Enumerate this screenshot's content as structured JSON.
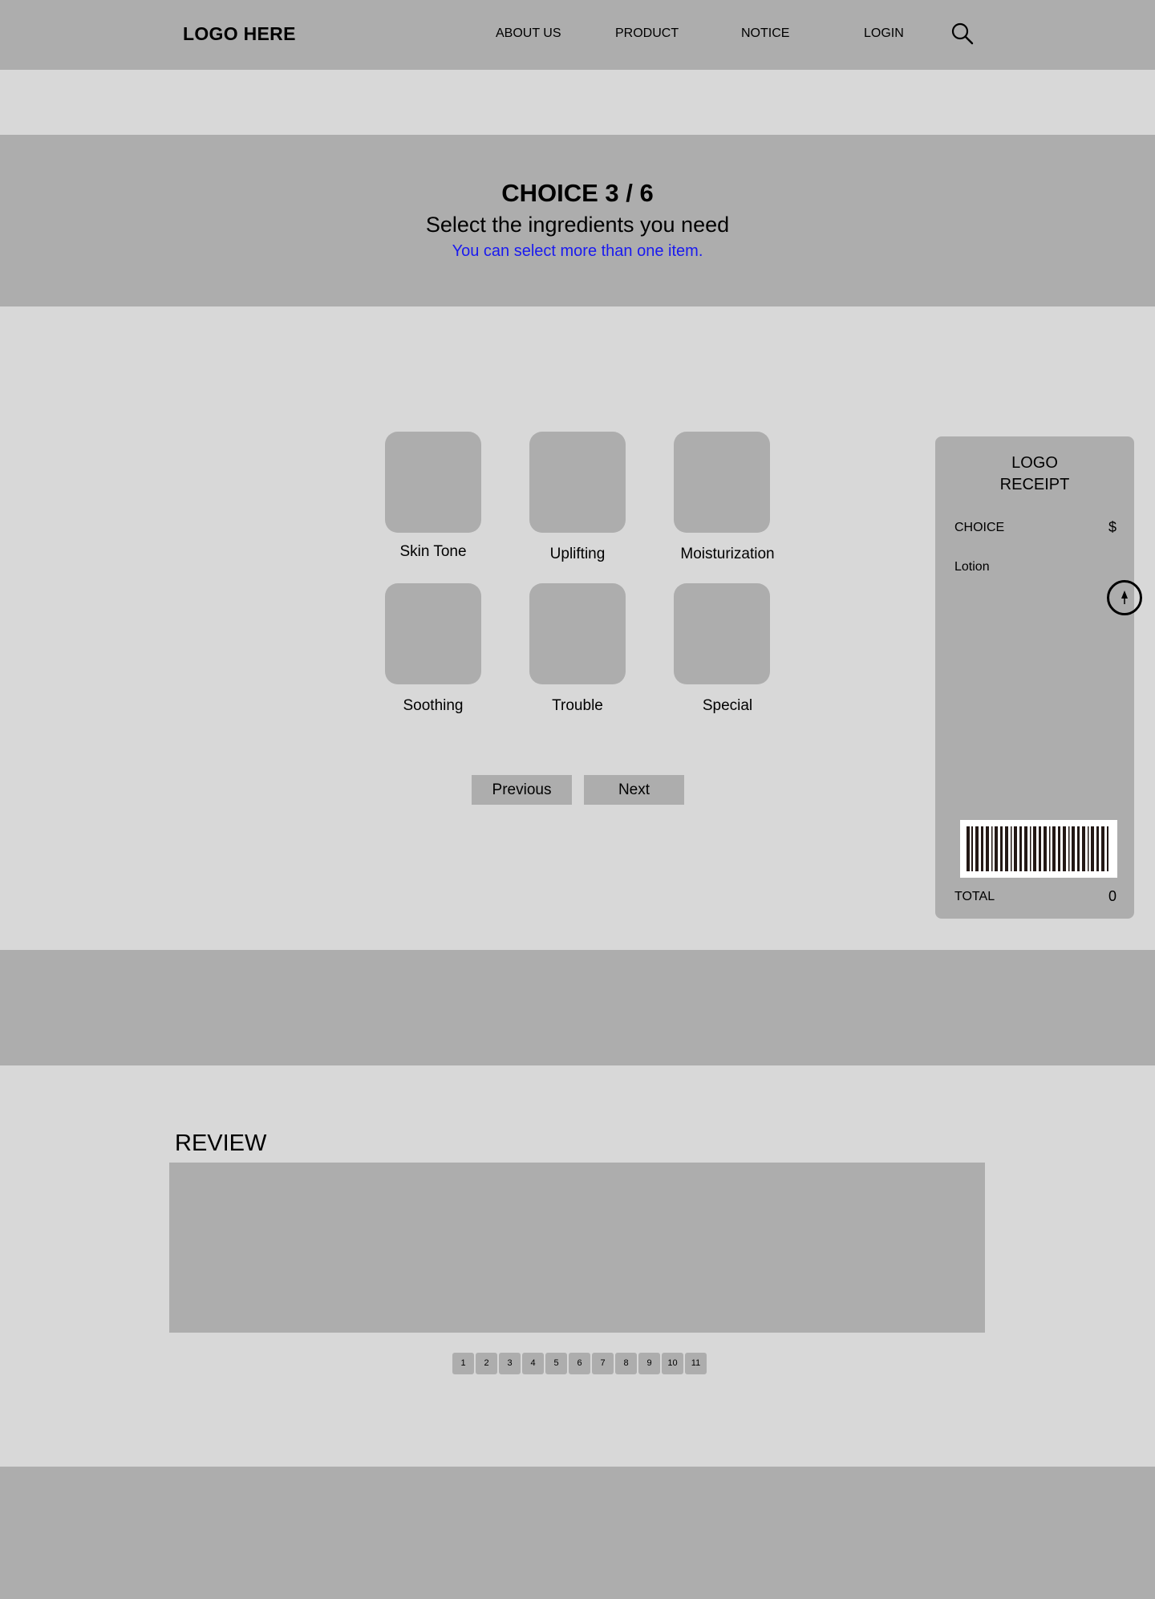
{
  "header": {
    "logo": "LOGO HERE",
    "nav": [
      "ABOUT US",
      "PRODUCT",
      "NOTICE",
      "LOGIN"
    ]
  },
  "hero": {
    "title": "CHOICE 3 / 6",
    "subtitle": "Select the ingredients you need",
    "note": "You can select more than one item."
  },
  "options": [
    "Skin Tone",
    "Uplifting",
    "Moisturization",
    "Soothing",
    "Trouble",
    "Special"
  ],
  "buttons": {
    "previous": "Previous",
    "next": "Next"
  },
  "receipt": {
    "logo_line1": "LOGO",
    "logo_line2": "RECEIPT",
    "choice_label": "CHOICE",
    "currency": "$",
    "item": "Lotion",
    "total_label": "TOTAL",
    "total_value": "0"
  },
  "review": {
    "title": "REVIEW",
    "pages": [
      "1",
      "2",
      "3",
      "4",
      "5",
      "6",
      "7",
      "8",
      "9",
      "10",
      "11"
    ]
  },
  "colors": {
    "block": "#adadad",
    "background": "#d8d8d8",
    "note": "#1a1af0"
  }
}
